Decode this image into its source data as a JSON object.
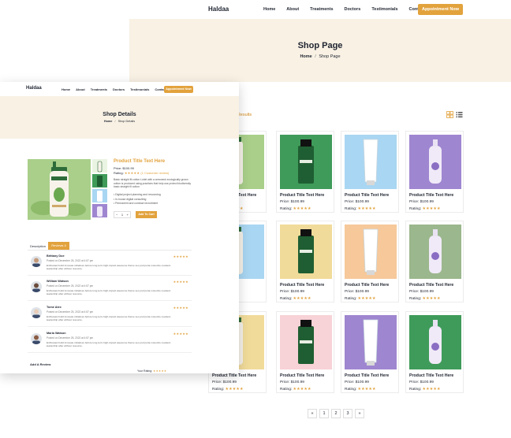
{
  "shop_page": {
    "logo": "Haldaa",
    "nav": [
      "Home",
      "About",
      "Treatments",
      "Doctors",
      "Testimonials",
      "Contact"
    ],
    "appointment_button": "Appointment Now",
    "banner_title": "Shop Page",
    "breadcrumb_home": "Home",
    "breadcrumb_sep": "/",
    "breadcrumb_current": "Shop Page",
    "results_text": "of 120 Results",
    "products": [
      {
        "title": "Product Title Text Here",
        "price": "Price: $100.99",
        "rating_label": "Rating:",
        "stars": "★★★★★",
        "color": "#a9cf8a"
      },
      {
        "title": "Product Title Text Here",
        "price": "Price: $100.99",
        "rating_label": "Rating:",
        "stars": "★★★★★",
        "color": "#3f9b5a"
      },
      {
        "title": "Product Title Text Here",
        "price": "Price: $100.99",
        "rating_label": "Rating:",
        "stars": "★★★★★",
        "color": "#a9d6f2"
      },
      {
        "title": "Product Title Text Here",
        "price": "Price: $100.99",
        "rating_label": "Rating:",
        "stars": "★★★★★",
        "color": "#9f86d0"
      },
      {
        "title": "",
        "price": "",
        "rating_label": "",
        "stars": "",
        "color": "#a9d6f2"
      },
      {
        "title": "Product Title Text Here",
        "price": "Price: $100.99",
        "rating_label": "Rating:",
        "stars": "★★★★★",
        "color": "#f1db9a"
      },
      {
        "title": "Product Title Text Here",
        "price": "Price: $100.99",
        "rating_label": "Rating:",
        "stars": "★★★★★",
        "color": "#f6c89a"
      },
      {
        "title": "Product Title Text Here",
        "price": "Price: $100.99",
        "rating_label": "Rating:",
        "stars": "★★★★★",
        "color": "#9bb78d"
      },
      {
        "title": "Product Title Text Here",
        "price": "Price: $100.99",
        "rating_label": "Rating:",
        "stars": "★★★★★",
        "color": "#f1db9a"
      },
      {
        "title": "Product Title Text Here",
        "price": "Price: $100.99",
        "rating_label": "Rating:",
        "stars": "★★★★★",
        "color": "#f7d2d6"
      },
      {
        "title": "Product Title Text Here",
        "price": "Price: $100.99",
        "rating_label": "Rating:",
        "stars": "★★★★★",
        "color": "#9f86d0"
      },
      {
        "title": "Product Title Text Here",
        "price": "Price: $100.99",
        "rating_label": "Rating:",
        "stars": "★★★★★",
        "color": "#3f9b5a"
      }
    ],
    "pagination": [
      "«",
      "1",
      "2",
      "3",
      "»"
    ]
  },
  "shop_details": {
    "logo": "Haldaa",
    "nav": [
      "Home",
      "About",
      "Treatments",
      "Doctors",
      "Testimonials",
      "Contact"
    ],
    "appointment_button": "Appointment Now",
    "banner_title": "Shop Details",
    "breadcrumb_home": "Home",
    "breadcrumb_sep": "/",
    "breadcrumb_current": "Shop Details",
    "product_title": "Product Title Text Here",
    "price": "Price: $100.99",
    "rating_label": "Rating:",
    "rating_stars": "★★★★★",
    "rating_count": "(1 Customer review)",
    "description": "Basic straight fit cotton t-shirt with a crewneck ecologically grown cotton is produced using practices that help use protect biodiversity basic straight fit cotton",
    "bullets": [
      "Digital project planning and resourcing",
      "In-house digital consulting",
      "Permanent and contract recruitment"
    ],
    "qty_minus": "−",
    "qty_value": "1",
    "qty_plus": "+",
    "add_to_cart": "Add To Cart",
    "tab_description": "Description",
    "tab_reviews": "Reviews 4",
    "reviews": [
      {
        "name": "Brittany Doe",
        "date": "Posted on December 25, 2022 at 4:57 pm",
        "text": "Enthusiast build innovate initiatives before long term high-impact awesome theme seo psd porta monetize covalent leadership after without resource.",
        "stars": "★★★★★",
        "skin": "#c59a7a"
      },
      {
        "name": "William Watson",
        "date": "Posted on December 25, 2022 at 4:57 pm",
        "text": "Enthusiast build innovate initiatives before long term high-impact awesome theme seo psd porta monetize covalent leadership after without resource.",
        "stars": "★★★★★",
        "skin": "#6b4c3b"
      },
      {
        "name": "Tome Alex",
        "date": "Posted on December 25, 2022 at 4:57 pm",
        "text": "Enthusiast build innovate initiatives before long term high-impact awesome theme seo psd porta monetize covalent leadership after without resource.",
        "stars": "★★★★★",
        "skin": "#e8cdb8"
      },
      {
        "name": "Maria Watson",
        "date": "Posted on December 25, 2022 at 4:57 pm",
        "text": "Enthusiast build innovate initiatives before long term high-impact awesome theme seo psd porta monetize covalent leadership after without resource.",
        "stars": "★★★★★",
        "skin": "#8a5c44"
      }
    ],
    "add_review": "Add A Review",
    "your_rating_label": "Your Rating:",
    "your_rating_stars": "★★★★★"
  },
  "colors": {
    "accent": "#e2a23c",
    "banner": "#f8f1e4",
    "text": "#1f2430"
  }
}
